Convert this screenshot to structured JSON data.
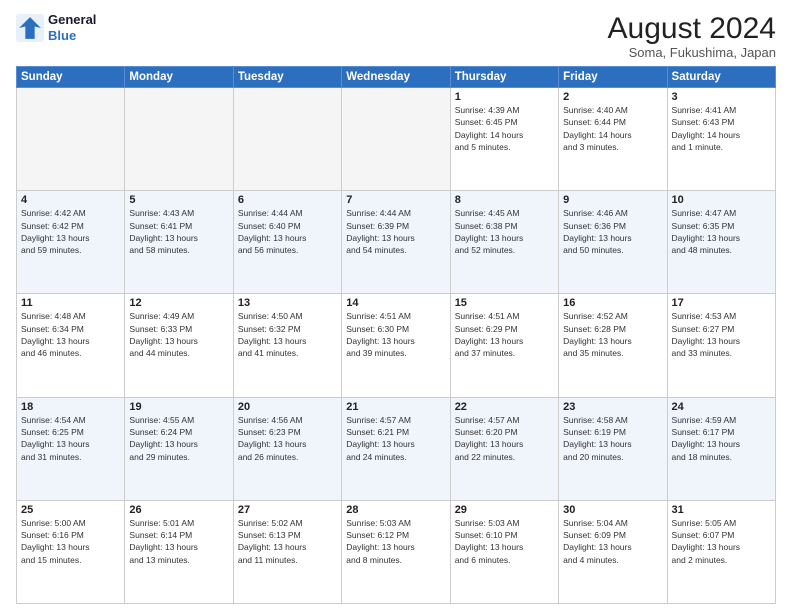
{
  "logo": {
    "line1": "General",
    "line2": "Blue"
  },
  "title": "August 2024",
  "subtitle": "Soma, Fukushima, Japan",
  "weekdays": [
    "Sunday",
    "Monday",
    "Tuesday",
    "Wednesday",
    "Thursday",
    "Friday",
    "Saturday"
  ],
  "weeks": [
    [
      {
        "day": "",
        "info": ""
      },
      {
        "day": "",
        "info": ""
      },
      {
        "day": "",
        "info": ""
      },
      {
        "day": "",
        "info": ""
      },
      {
        "day": "1",
        "info": "Sunrise: 4:39 AM\nSunset: 6:45 PM\nDaylight: 14 hours\nand 5 minutes."
      },
      {
        "day": "2",
        "info": "Sunrise: 4:40 AM\nSunset: 6:44 PM\nDaylight: 14 hours\nand 3 minutes."
      },
      {
        "day": "3",
        "info": "Sunrise: 4:41 AM\nSunset: 6:43 PM\nDaylight: 14 hours\nand 1 minute."
      }
    ],
    [
      {
        "day": "4",
        "info": "Sunrise: 4:42 AM\nSunset: 6:42 PM\nDaylight: 13 hours\nand 59 minutes."
      },
      {
        "day": "5",
        "info": "Sunrise: 4:43 AM\nSunset: 6:41 PM\nDaylight: 13 hours\nand 58 minutes."
      },
      {
        "day": "6",
        "info": "Sunrise: 4:44 AM\nSunset: 6:40 PM\nDaylight: 13 hours\nand 56 minutes."
      },
      {
        "day": "7",
        "info": "Sunrise: 4:44 AM\nSunset: 6:39 PM\nDaylight: 13 hours\nand 54 minutes."
      },
      {
        "day": "8",
        "info": "Sunrise: 4:45 AM\nSunset: 6:38 PM\nDaylight: 13 hours\nand 52 minutes."
      },
      {
        "day": "9",
        "info": "Sunrise: 4:46 AM\nSunset: 6:36 PM\nDaylight: 13 hours\nand 50 minutes."
      },
      {
        "day": "10",
        "info": "Sunrise: 4:47 AM\nSunset: 6:35 PM\nDaylight: 13 hours\nand 48 minutes."
      }
    ],
    [
      {
        "day": "11",
        "info": "Sunrise: 4:48 AM\nSunset: 6:34 PM\nDaylight: 13 hours\nand 46 minutes."
      },
      {
        "day": "12",
        "info": "Sunrise: 4:49 AM\nSunset: 6:33 PM\nDaylight: 13 hours\nand 44 minutes."
      },
      {
        "day": "13",
        "info": "Sunrise: 4:50 AM\nSunset: 6:32 PM\nDaylight: 13 hours\nand 41 minutes."
      },
      {
        "day": "14",
        "info": "Sunrise: 4:51 AM\nSunset: 6:30 PM\nDaylight: 13 hours\nand 39 minutes."
      },
      {
        "day": "15",
        "info": "Sunrise: 4:51 AM\nSunset: 6:29 PM\nDaylight: 13 hours\nand 37 minutes."
      },
      {
        "day": "16",
        "info": "Sunrise: 4:52 AM\nSunset: 6:28 PM\nDaylight: 13 hours\nand 35 minutes."
      },
      {
        "day": "17",
        "info": "Sunrise: 4:53 AM\nSunset: 6:27 PM\nDaylight: 13 hours\nand 33 minutes."
      }
    ],
    [
      {
        "day": "18",
        "info": "Sunrise: 4:54 AM\nSunset: 6:25 PM\nDaylight: 13 hours\nand 31 minutes."
      },
      {
        "day": "19",
        "info": "Sunrise: 4:55 AM\nSunset: 6:24 PM\nDaylight: 13 hours\nand 29 minutes."
      },
      {
        "day": "20",
        "info": "Sunrise: 4:56 AM\nSunset: 6:23 PM\nDaylight: 13 hours\nand 26 minutes."
      },
      {
        "day": "21",
        "info": "Sunrise: 4:57 AM\nSunset: 6:21 PM\nDaylight: 13 hours\nand 24 minutes."
      },
      {
        "day": "22",
        "info": "Sunrise: 4:57 AM\nSunset: 6:20 PM\nDaylight: 13 hours\nand 22 minutes."
      },
      {
        "day": "23",
        "info": "Sunrise: 4:58 AM\nSunset: 6:19 PM\nDaylight: 13 hours\nand 20 minutes."
      },
      {
        "day": "24",
        "info": "Sunrise: 4:59 AM\nSunset: 6:17 PM\nDaylight: 13 hours\nand 18 minutes."
      }
    ],
    [
      {
        "day": "25",
        "info": "Sunrise: 5:00 AM\nSunset: 6:16 PM\nDaylight: 13 hours\nand 15 minutes."
      },
      {
        "day": "26",
        "info": "Sunrise: 5:01 AM\nSunset: 6:14 PM\nDaylight: 13 hours\nand 13 minutes."
      },
      {
        "day": "27",
        "info": "Sunrise: 5:02 AM\nSunset: 6:13 PM\nDaylight: 13 hours\nand 11 minutes."
      },
      {
        "day": "28",
        "info": "Sunrise: 5:03 AM\nSunset: 6:12 PM\nDaylight: 13 hours\nand 8 minutes."
      },
      {
        "day": "29",
        "info": "Sunrise: 5:03 AM\nSunset: 6:10 PM\nDaylight: 13 hours\nand 6 minutes."
      },
      {
        "day": "30",
        "info": "Sunrise: 5:04 AM\nSunset: 6:09 PM\nDaylight: 13 hours\nand 4 minutes."
      },
      {
        "day": "31",
        "info": "Sunrise: 5:05 AM\nSunset: 6:07 PM\nDaylight: 13 hours\nand 2 minutes."
      }
    ]
  ]
}
